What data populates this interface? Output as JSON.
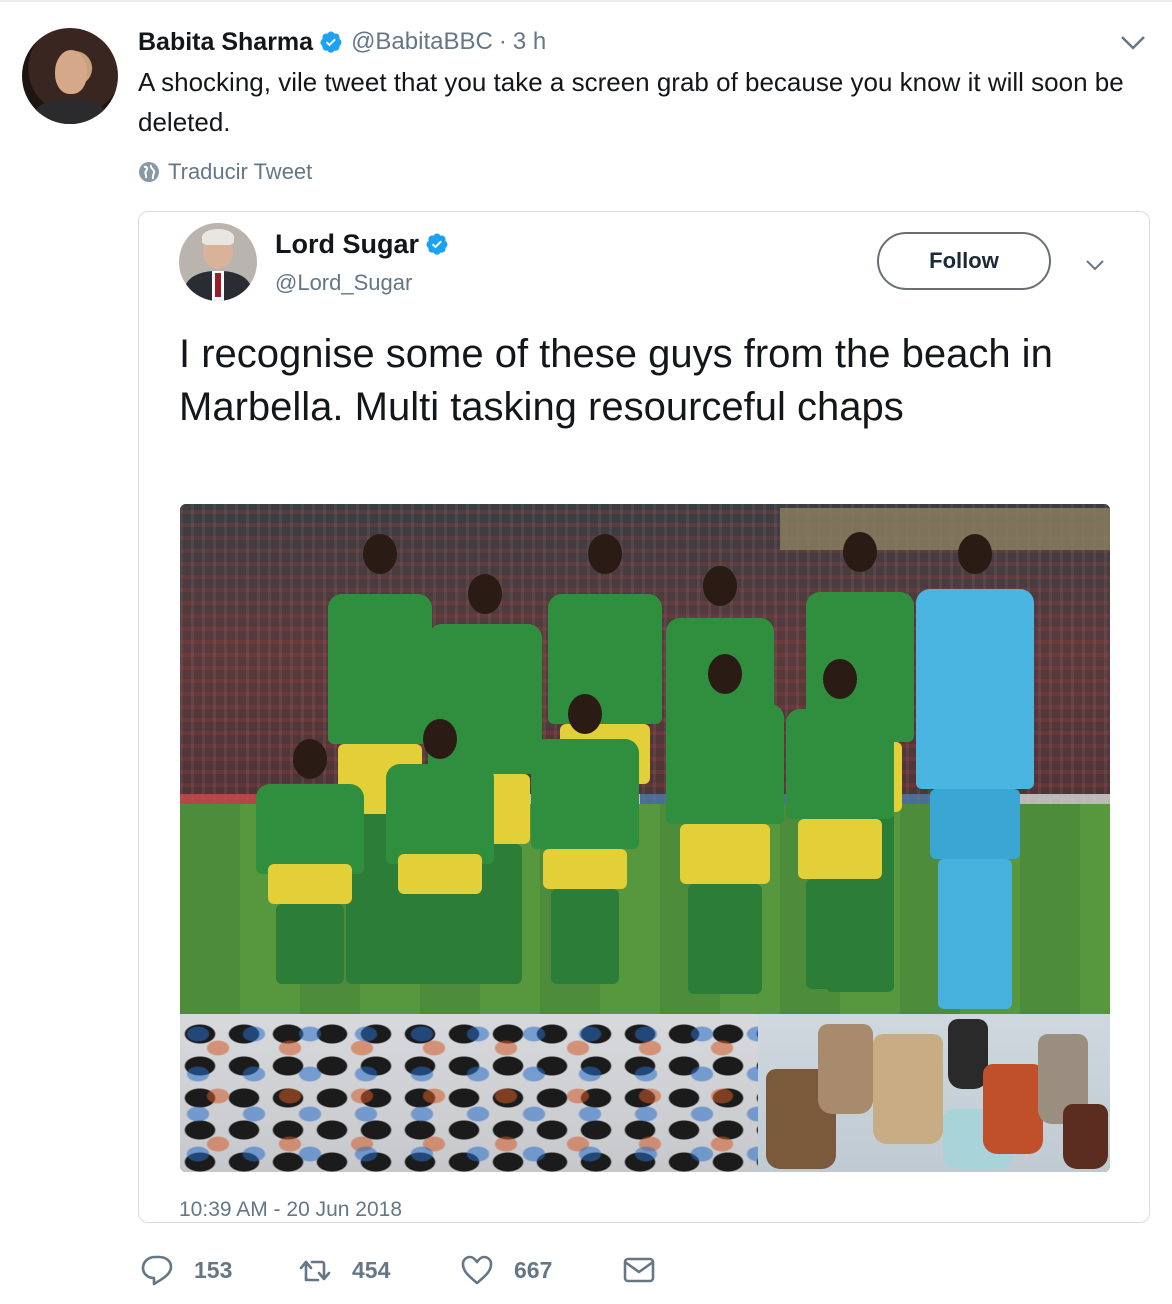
{
  "outer_tweet": {
    "author_name": "Babita Sharma",
    "handle": "@BabitaBBC",
    "separator": "·",
    "time": "3 h",
    "text": "A shocking, vile tweet that you take a screen grab of because you know it will soon be deleted.",
    "translate_label": "Traducir Tweet"
  },
  "embedded_tweet": {
    "author_name": "Lord Sugar",
    "handle": "@Lord_Sugar",
    "follow_label": "Follow",
    "text": "I recognise some of these guys from the beach in Marbella. Multi tasking resourceful chaps",
    "timestamp": "10:39 AM - 20 Jun 2018"
  },
  "actions": {
    "replies": "153",
    "retweets": "454",
    "likes": "667"
  },
  "colors": {
    "verified": "#1da1f2",
    "secondary_text": "#657786",
    "primary_text": "#14171a",
    "border": "#d6dde3"
  },
  "icons": {
    "verified": "verified-badge-icon",
    "caret": "chevron-down-icon",
    "globe": "globe-icon",
    "reply": "reply-icon",
    "retweet": "retweet-icon",
    "like": "heart-icon",
    "message": "envelope-icon"
  }
}
